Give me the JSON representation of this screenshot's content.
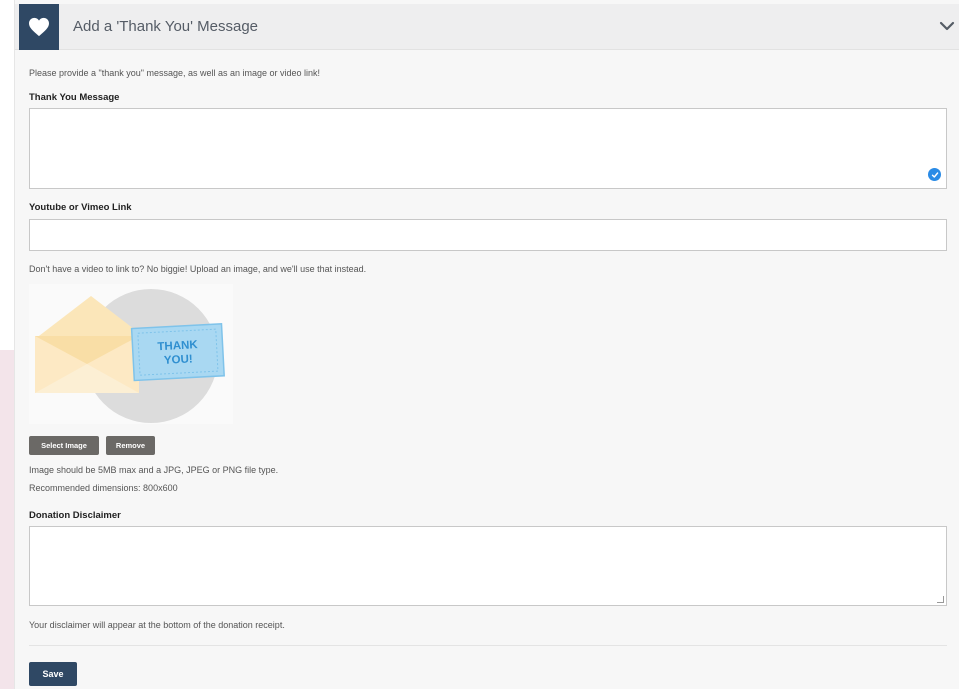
{
  "header": {
    "title": "Add a 'Thank You' Message"
  },
  "intro_text": "Please provide a \"thank you\" message, as well as an image or video link!",
  "thank_you": {
    "label": "Thank You Message",
    "value": ""
  },
  "video": {
    "label": "Youtube or Vimeo Link",
    "value": ""
  },
  "upload_hint": "Don't have a video to link to? No biggie! Upload an image, and we'll use that instead.",
  "image": {
    "card_line1": "THANK",
    "card_line2": "YOU!",
    "select_label": "Select Image",
    "remove_label": "Remove",
    "size_hint": "Image should be 5MB max and a JPG, JPEG or PNG file type.",
    "dimensions_hint": "Recommended dimensions: 800x600"
  },
  "disclaimer": {
    "label": "Donation Disclaimer",
    "value": "",
    "help": "Your disclaimer will appear at the bottom of the donation receipt."
  },
  "save_label": "Save",
  "colors": {
    "brand": "#2f4864",
    "button_gray": "#6b6966",
    "check_blue": "#2a8be6"
  }
}
